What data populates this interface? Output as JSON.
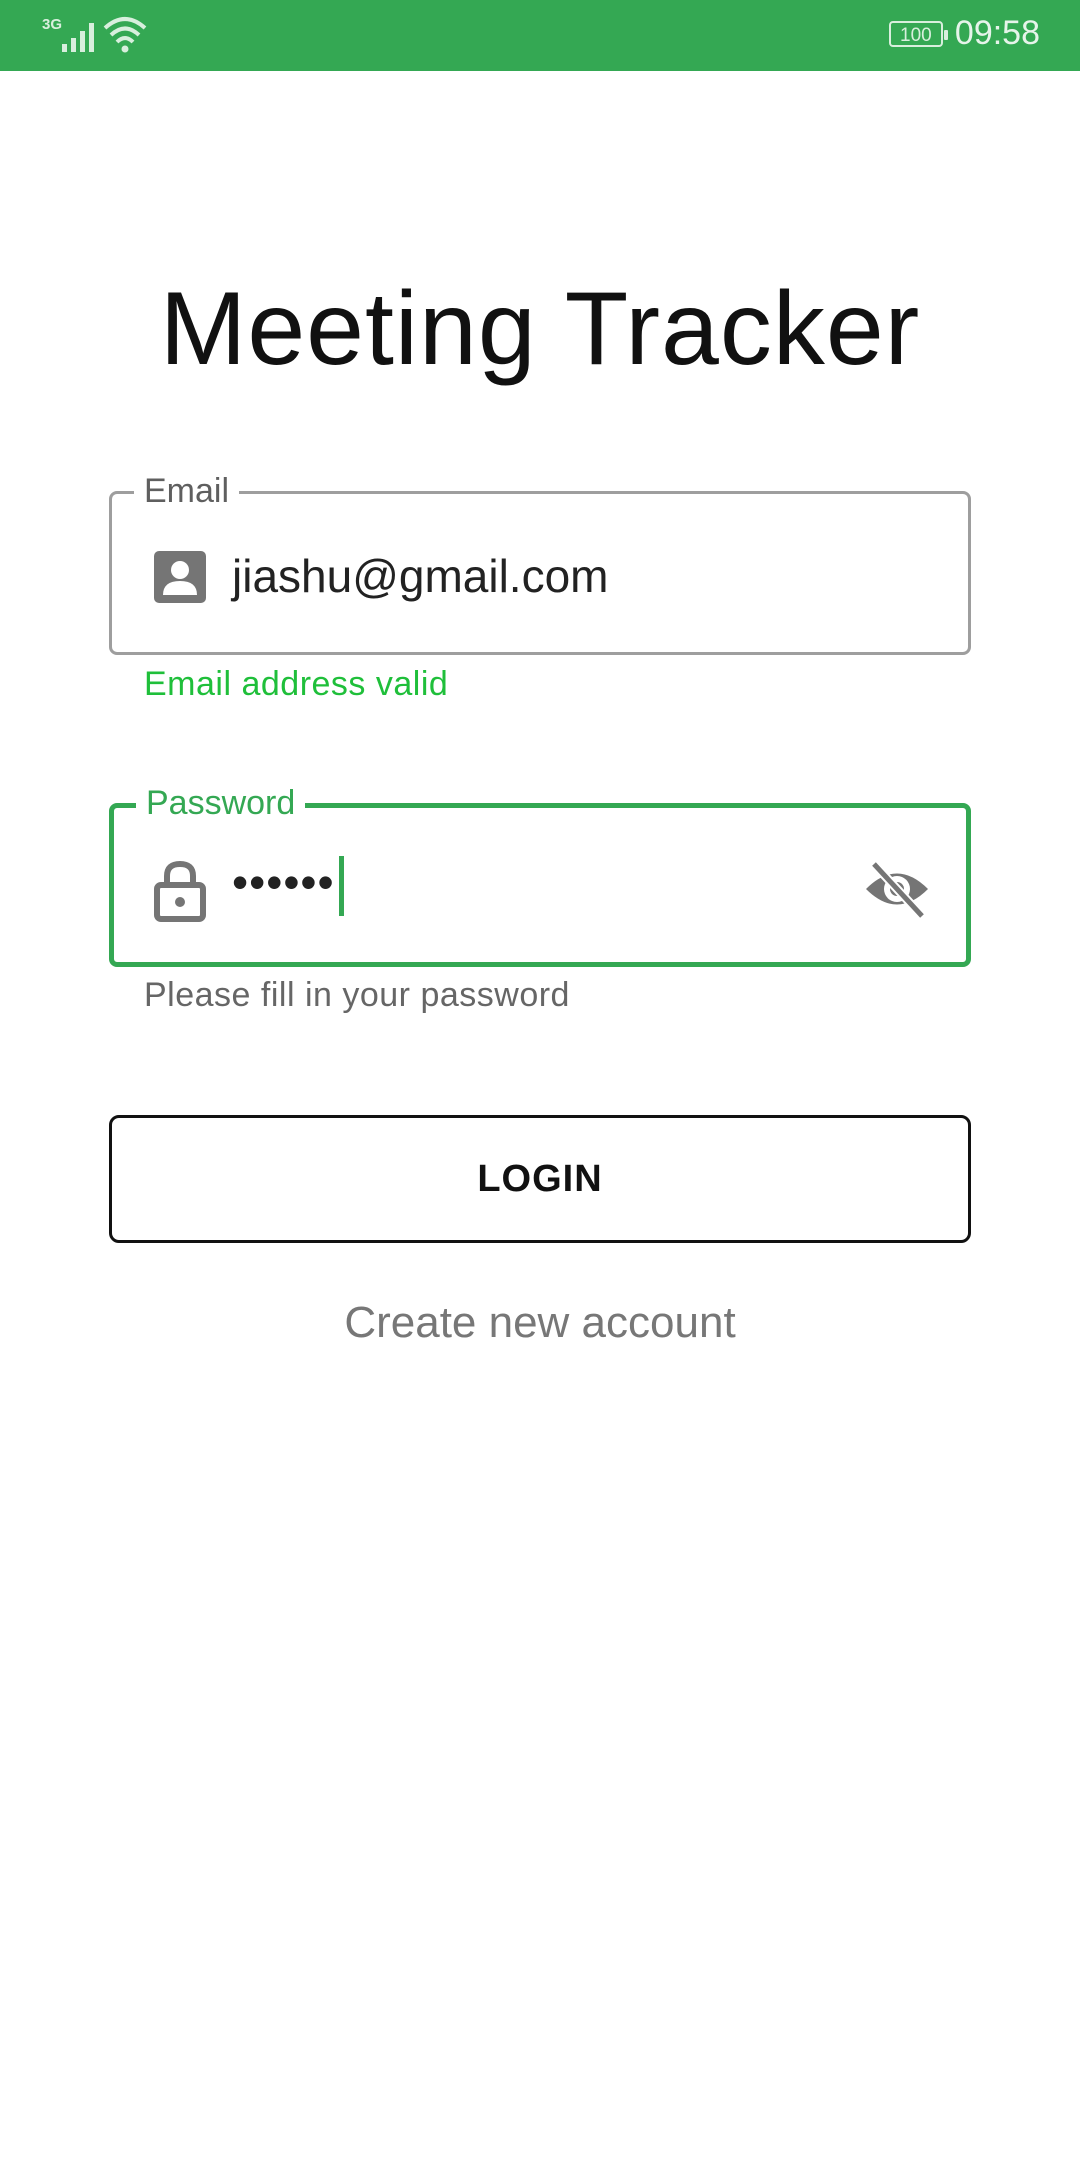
{
  "status_bar": {
    "network": "3G",
    "battery": "100",
    "time": "09:58",
    "icons": [
      "signal-icon",
      "wifi-icon",
      "battery-icon"
    ]
  },
  "app": {
    "title": "Meeting Tracker"
  },
  "email_field": {
    "label": "Email",
    "value": "jiashu@gmail.com",
    "helper": "Email address valid",
    "icon": "account-box-icon"
  },
  "password_field": {
    "label": "Password",
    "value": "••••••",
    "helper": "Please fill in your password",
    "icon": "lock-icon",
    "toggle_icon": "visibility-off-icon"
  },
  "actions": {
    "login_label": "LOGIN",
    "create_account_label": "Create new account"
  },
  "colors": {
    "accent": "#34a853",
    "valid": "#1fbf3a",
    "muted": "#777777"
  }
}
